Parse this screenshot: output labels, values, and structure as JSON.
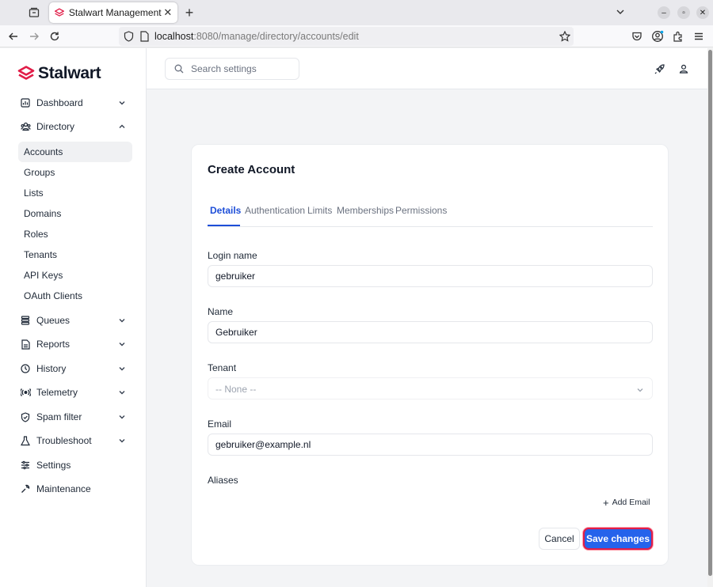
{
  "browser": {
    "tab_title": "Stalwart Management",
    "url_host": "localhost",
    "url_rest": ":8080/manage/directory/accounts/edit"
  },
  "colors": {
    "accent": "#2563eb",
    "brand": "#e11d48",
    "active_tab": "#1d4ed8"
  },
  "sidebar": {
    "brand": "Stalwart",
    "items": [
      {
        "label": "Dashboard",
        "icon": "chart-icon",
        "expandable": true,
        "expanded": false
      },
      {
        "label": "Directory",
        "icon": "directory-icon",
        "expandable": true,
        "expanded": true
      },
      {
        "label": "Queues",
        "icon": "queue-icon",
        "expandable": true,
        "expanded": false
      },
      {
        "label": "Reports",
        "icon": "report-icon",
        "expandable": true,
        "expanded": false
      },
      {
        "label": "History",
        "icon": "clock-icon",
        "expandable": true,
        "expanded": false
      },
      {
        "label": "Telemetry",
        "icon": "telemetry-icon",
        "expandable": true,
        "expanded": false
      },
      {
        "label": "Spam filter",
        "icon": "shield-icon",
        "expandable": true,
        "expanded": false
      },
      {
        "label": "Troubleshoot",
        "icon": "flask-icon",
        "expandable": true,
        "expanded": false
      },
      {
        "label": "Settings",
        "icon": "sliders-icon",
        "expandable": false
      },
      {
        "label": "Maintenance",
        "icon": "wrench-icon",
        "expandable": false
      }
    ],
    "directory_sub": [
      "Accounts",
      "Groups",
      "Lists",
      "Domains",
      "Roles",
      "Tenants",
      "API Keys",
      "OAuth Clients"
    ]
  },
  "header": {
    "search_placeholder": "Search settings"
  },
  "form": {
    "title": "Create Account",
    "tabs": [
      "Details",
      "Authentication",
      "Limits",
      "Memberships",
      "Permissions"
    ],
    "active_tab": "Details",
    "login_name": {
      "label": "Login name",
      "value": "gebruiker"
    },
    "name": {
      "label": "Name",
      "value": "Gebruiker"
    },
    "tenant": {
      "label": "Tenant",
      "value": "-- None --"
    },
    "email": {
      "label": "Email",
      "value": "gebruiker@example.nl"
    },
    "aliases": {
      "label": "Aliases",
      "add_label": "Add Email"
    },
    "cancel_label": "Cancel",
    "save_label": "Save changes"
  }
}
